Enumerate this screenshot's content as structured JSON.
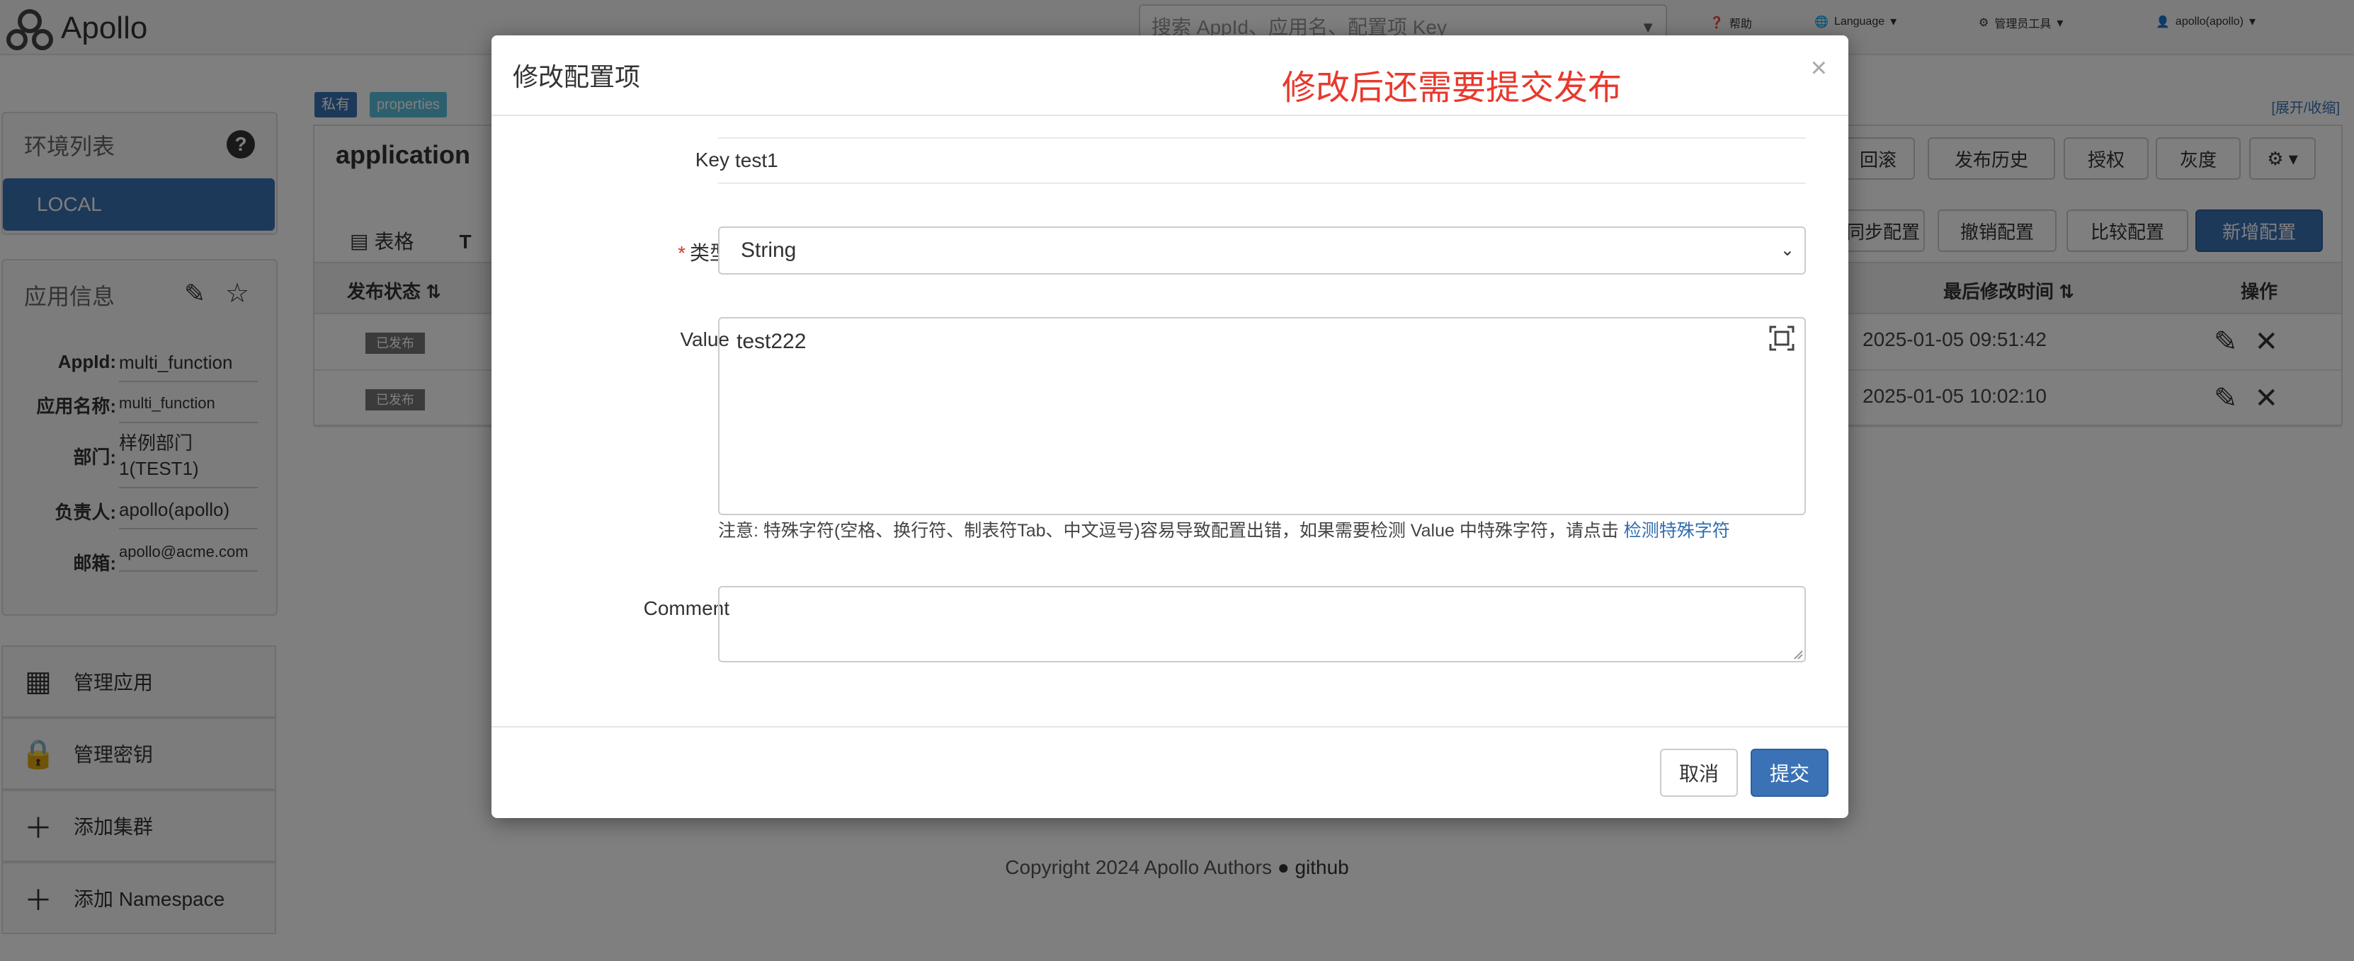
{
  "app": {
    "brand": "Apollo"
  },
  "nav": {
    "search_placeholder": "搜索 AppId、应用名、配置项 Key",
    "help": "帮助",
    "language": "Language",
    "admin_tools": "管理员工具",
    "user": "apollo(apollo)"
  },
  "sidebar": {
    "env_title": "环境列表",
    "env_local": "LOCAL",
    "app_info_title": "应用信息",
    "info": [
      {
        "key": "AppId:",
        "value": "multi_function"
      },
      {
        "key": "应用名称:",
        "value": "multi_function"
      },
      {
        "key": "部门:",
        "value": "样例部门1(TEST1)"
      },
      {
        "key": "负责人:",
        "value": "apollo(apollo)"
      },
      {
        "key": "邮箱:",
        "value": "apollo@acme.com"
      }
    ],
    "menu": [
      {
        "label": "管理应用",
        "icon": "grid-icon"
      },
      {
        "label": "管理密钥",
        "icon": "lock-icon"
      },
      {
        "label": "添加集群",
        "icon": "plus-icon"
      },
      {
        "label": "添加 Namespace",
        "icon": "plus-icon"
      }
    ]
  },
  "namespace": {
    "tag_private": "私有",
    "tag_format": "properties",
    "expand_collapse": "[展开/收缩]",
    "title": "application",
    "toolbar": [
      "回滚",
      "发布历史",
      "授权",
      "灰度"
    ],
    "toolbar2": [
      "同步配置",
      "撤销配置",
      "比较配置",
      "新增配置"
    ],
    "tabs": [
      "表格",
      "T"
    ],
    "table": {
      "headers": {
        "status": "发布状态",
        "modified": "最后修改时间",
        "ops": "操作"
      },
      "rows": [
        {
          "status": "已发布",
          "modified": "2025-01-05 09:51:42"
        },
        {
          "status": "已发布",
          "modified": "2025-01-05 10:02:10"
        }
      ]
    }
  },
  "footer": {
    "copyright": "Copyright 2024 Apollo Authors",
    "github": "github"
  },
  "modal": {
    "title": "修改配置项",
    "annotation": "修改后还需要提交发布",
    "key_label": "Key",
    "key_value": "test1",
    "type_label": "类型",
    "type_value": "String",
    "value_label": "Value",
    "value_value": "test222",
    "note_text": "注意: 特殊字符(空格、换行符、制表符Tab、中文逗号)容易导致配置出错，如果需要检测 Value 中特殊字符，请点击",
    "note_link": "检测特殊字符",
    "comment_label": "Comment",
    "comment_value": "",
    "cancel": "取消",
    "submit": "提交"
  },
  "colors": {
    "primary": "#3b72b5",
    "annotation": "#e8392c",
    "backdrop": "rgba(0,0,0,0.5)"
  }
}
